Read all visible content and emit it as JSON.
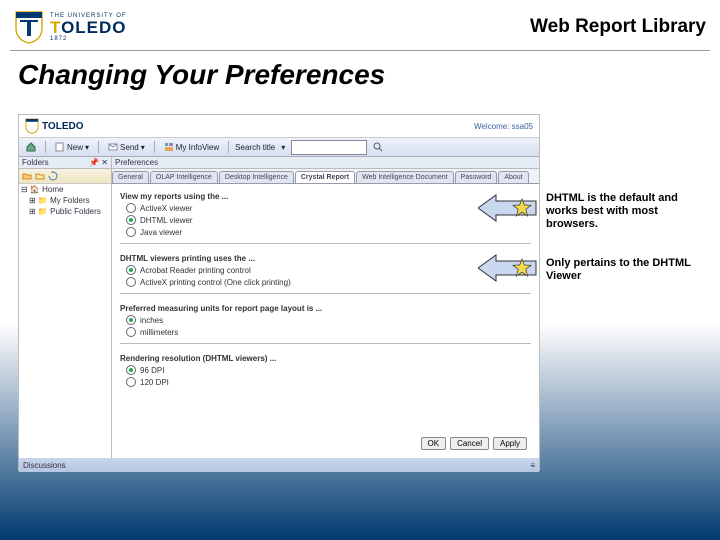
{
  "header": {
    "logo_the": "THE UNIVERSITY OF",
    "logo_name_t": "T",
    "logo_name_rest": "OLEDO",
    "logo_year": "1872",
    "right_text": "Web Report  Library"
  },
  "slide_title": "Changing Your Preferences",
  "app": {
    "logo_text": "TOLEDO",
    "welcome": "Welcome: ssa05",
    "toolbar": {
      "home": "",
      "new": "New",
      "send": "Send",
      "myinfoview": "My InfoView",
      "search_label": "Search title",
      "search_value": ""
    },
    "folders": {
      "title": "Folders",
      "items": [
        "Home",
        "My Folders",
        "Public Folders"
      ]
    },
    "prefs_title": "Preferences",
    "tabs": [
      "General",
      "OLAP Intelligence",
      "Desktop Intelligence",
      "Crystal Report",
      "Web Intelligence Document",
      "Password",
      "About"
    ],
    "section_view": "View my reports using the ...",
    "view_opts": [
      "ActiveX viewer",
      "DHTML viewer",
      "Java viewer"
    ],
    "section_print": "DHTML viewers printing uses the ...",
    "print_opts": [
      "Acrobat Reader printing control",
      "ActiveX printing control (One click printing)"
    ],
    "section_units": "Preferred measuring units for report page layout is ...",
    "unit_opts": [
      "inches",
      "millimeters"
    ],
    "section_dpi": "Rendering resolution (DHTML viewers) ...",
    "dpi_opts": [
      "96 DPI",
      "120 DPI"
    ],
    "buttons": {
      "ok": "OK",
      "cancel": "Cancel",
      "apply": "Apply"
    },
    "bottom_bar": "Discussions"
  },
  "annotations": {
    "a1": "DHTML is the default and works best with most browsers.",
    "a2": "Only pertains to the DHTML Viewer"
  }
}
